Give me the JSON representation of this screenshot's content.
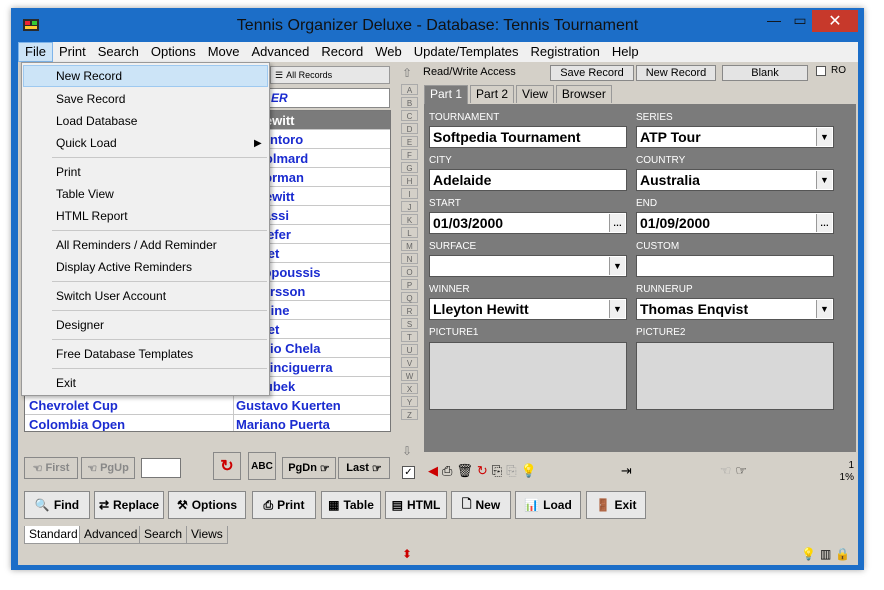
{
  "window": {
    "title": "Tennis Organizer Deluxe - Database: Tennis Tournament",
    "close": "✕",
    "minimize": "—",
    "maximize": "▭"
  },
  "menubar": [
    "File",
    "Print",
    "Search",
    "Options",
    "Move",
    "Advanced",
    "Record",
    "Web",
    "Update/Templates",
    "Registration",
    "Help"
  ],
  "file_menu": {
    "items": [
      "New Record",
      "Save Record",
      "Load Database",
      "Quick Load",
      "Print",
      "Table View",
      "HTML Report",
      "All Reminders / Add Reminder",
      "Display Active Reminders",
      "Switch User Account",
      "Designer",
      "Free Database Templates",
      "Exit"
    ],
    "quick_load_arrow": "▶"
  },
  "left": {
    "all_records": "All Records",
    "filter_text": "ER",
    "rows": [
      {
        "c1": "",
        "c2": "on Hewitt",
        "selected": true
      },
      {
        "c1": "",
        "c2": "ce Santoro"
      },
      {
        "c1": "",
        "c2": "ne Golmard"
      },
      {
        "c1": "",
        "c2": "us Norman"
      },
      {
        "c1": "",
        "c2": "on Hewitt"
      },
      {
        "c1": "",
        "c2": "e Agassi"
      },
      {
        "c1": "",
        "c2": "as Kiefer"
      },
      {
        "c1": "",
        "c2": "Rosset"
      },
      {
        "c1": "",
        "c2": "Philippoussis"
      },
      {
        "c1": "",
        "c2": "us Larsson"
      },
      {
        "c1": "",
        "c2": "c Pioline"
      },
      {
        "c1": "",
        "c2": "Rosset"
      },
      {
        "c1": "",
        "c2": "Ignacio Chela"
      },
      {
        "c1": "",
        "c2": "eas Vinciguerra"
      },
      {
        "c1": "",
        "c2": "n Koubek"
      },
      {
        "c1": "Chevrolet Cup",
        "c2": "Gustavo Kuerten"
      },
      {
        "c1": "Colombia Open",
        "c2": "Mariano Puerta"
      }
    ],
    "alpha": [
      "A",
      "B",
      "C",
      "D",
      "E",
      "F",
      "G",
      "H",
      "I",
      "J",
      "K",
      "L",
      "M",
      "N",
      "O",
      "P",
      "Q",
      "R",
      "S",
      "T",
      "U",
      "V",
      "W",
      "X",
      "Y",
      "Z"
    ],
    "nav": {
      "first": "First",
      "pgup": "PgUp",
      "pgdn": "PgDn",
      "last": "Last"
    }
  },
  "right": {
    "access": "Read/Write Access",
    "save_record": "Save Record",
    "new_record": "New Record",
    "blank": "Blank",
    "ro": "RO",
    "tabs": [
      "Part 1",
      "Part 2",
      "View",
      "Browser"
    ],
    "fields": {
      "tournament_label": "TOURNAMENT",
      "tournament": "Softpedia Tournament",
      "series_label": "SERIES",
      "series": "ATP Tour",
      "city_label": "CITY",
      "city": "Adelaide",
      "country_label": "COUNTRY",
      "country": "Australia",
      "start_label": "START",
      "start": "01/03/2000",
      "end_label": "END",
      "end": "01/09/2000",
      "surface_label": "SURFACE",
      "surface": "",
      "custom_label": "CUSTOM",
      "custom": "",
      "winner_label": "WINNER",
      "winner": "Lleyton Hewitt",
      "runnerup_label": "RUNNERUP",
      "runnerup": "Thomas Enqvist",
      "picture1_label": "PICTURE1",
      "picture2_label": "PICTURE2"
    },
    "record_counter": "1",
    "record_percent": "1%"
  },
  "toolbar": {
    "find": "Find",
    "replace": "Replace",
    "options": "Options",
    "print": "Print",
    "table": "Table",
    "html": "HTML",
    "new": "New",
    "load": "Load",
    "exit": "Exit"
  },
  "bottom_tabs": [
    "Standard",
    "Advanced",
    "Search",
    "Views"
  ],
  "colors": {
    "titlebar": "#1c6ec8",
    "list_text": "#1a2bd0",
    "form_bg": "#7b7b7b",
    "close": "#c7392b"
  }
}
